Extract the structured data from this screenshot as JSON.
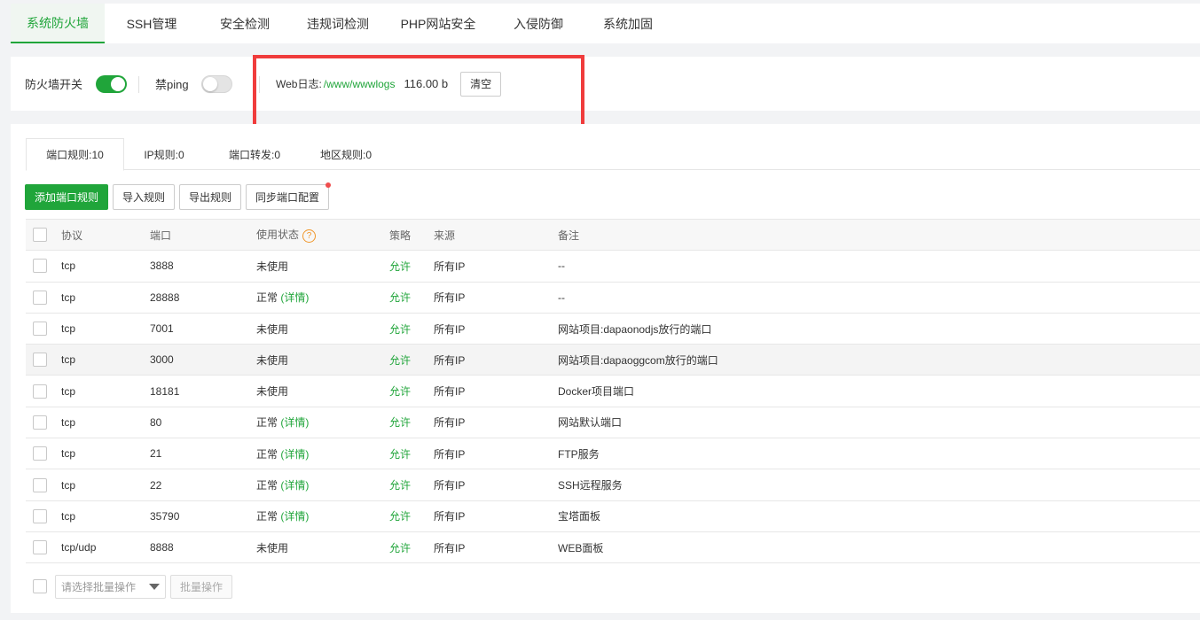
{
  "topnav": {
    "tabs": [
      "系统防火墙",
      "SSH管理",
      "安全检测",
      "违规词检测",
      "PHP网站安全",
      "入侵防御",
      "系统加固"
    ],
    "active_index": 0
  },
  "status": {
    "firewall_label": "防火墙开关",
    "firewall_on": true,
    "ping_label": "禁ping",
    "ping_on": false,
    "weblog_label": "Web日志:",
    "weblog_path": "/www/wwwlogs",
    "weblog_size": "116.00 b",
    "clear_label": "清空"
  },
  "subtabs": {
    "port_rules": "端口规则:10",
    "ip_rules": "IP规则:0",
    "port_forward": "端口转发:0",
    "region_rules": "地区规则:0"
  },
  "toolbar": {
    "add": "添加端口规则",
    "import": "导入规则",
    "export": "导出规则",
    "sync": "同步端口配置"
  },
  "table": {
    "headers": {
      "protocol": "协议",
      "port": "端口",
      "status": "使用状态",
      "policy": "策略",
      "source": "来源",
      "note": "备注"
    },
    "detail_label": "(详情)",
    "rows": [
      {
        "protocol": "tcp",
        "port": "3888",
        "status": "未使用",
        "detail": false,
        "policy": "允许",
        "source": "所有IP",
        "note": "--"
      },
      {
        "protocol": "tcp",
        "port": "28888",
        "status": "正常",
        "detail": true,
        "policy": "允许",
        "source": "所有IP",
        "note": "--"
      },
      {
        "protocol": "tcp",
        "port": "7001",
        "status": "未使用",
        "detail": false,
        "policy": "允许",
        "source": "所有IP",
        "note": "网站项目:dapaonodjs放行的端口"
      },
      {
        "protocol": "tcp",
        "port": "3000",
        "status": "未使用",
        "detail": false,
        "policy": "允许",
        "source": "所有IP",
        "note": "网站项目:dapaoggcom放行的端口"
      },
      {
        "protocol": "tcp",
        "port": "18181",
        "status": "未使用",
        "detail": false,
        "policy": "允许",
        "source": "所有IP",
        "note": "Docker项目端口"
      },
      {
        "protocol": "tcp",
        "port": "80",
        "status": "正常",
        "detail": true,
        "policy": "允许",
        "source": "所有IP",
        "note": "网站默认端口"
      },
      {
        "protocol": "tcp",
        "port": "21",
        "status": "正常",
        "detail": true,
        "policy": "允许",
        "source": "所有IP",
        "note": "FTP服务"
      },
      {
        "protocol": "tcp",
        "port": "22",
        "status": "正常",
        "detail": true,
        "policy": "允许",
        "source": "所有IP",
        "note": "SSH远程服务"
      },
      {
        "protocol": "tcp",
        "port": "35790",
        "status": "正常",
        "detail": true,
        "policy": "允许",
        "source": "所有IP",
        "note": "宝塔面板"
      },
      {
        "protocol": "tcp/udp",
        "port": "8888",
        "status": "未使用",
        "detail": false,
        "policy": "允许",
        "source": "所有IP",
        "note": "WEB面板"
      }
    ]
  },
  "footer": {
    "batch_placeholder": "请选择批量操作",
    "batch_button": "批量操作"
  },
  "colors": {
    "accent": "#20a53a",
    "highlight": "#f03c3c"
  }
}
